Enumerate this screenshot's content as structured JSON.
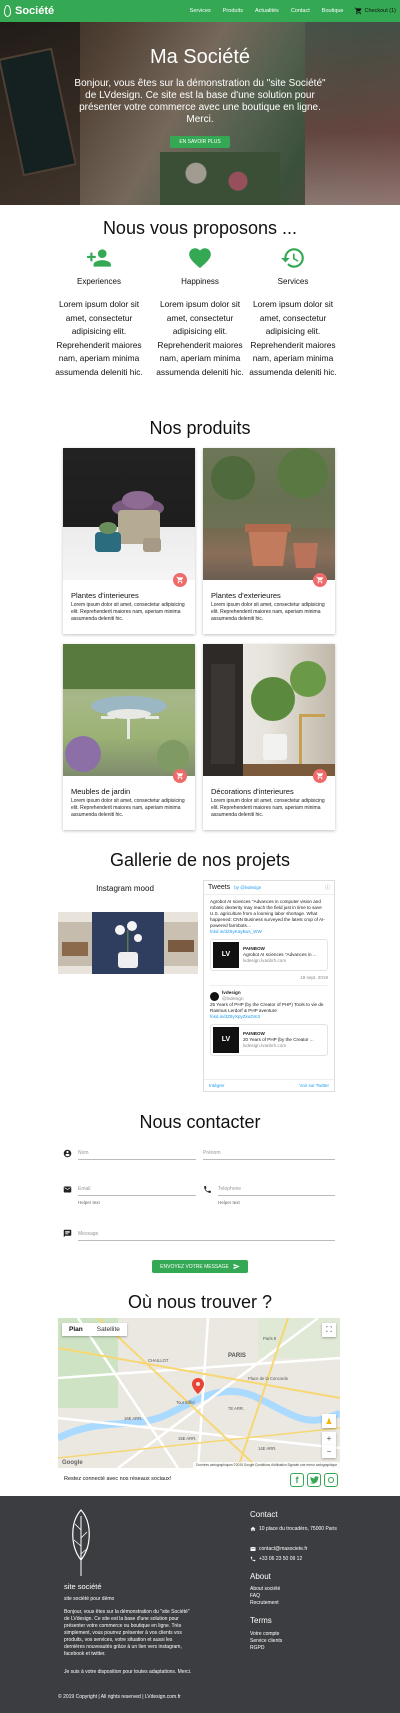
{
  "nav": {
    "brand": "Société",
    "links": [
      "Services",
      "Produits",
      "Actualités",
      "Contact",
      "Boutique"
    ],
    "cart": "Checkout (1)"
  },
  "hero": {
    "title": "Ma Société",
    "text": "Bonjour, vous êtes sur la démonstration du \"site Société\" de LVdesign. Ce site est la base d'une solution pour présenter votre commerce avec une boutique en ligne. Merci.",
    "button": "EN SAVOIR PLUS"
  },
  "services": {
    "title": "Nous vous proposons ...",
    "items": [
      {
        "title": "Experiences",
        "text": "Lorem ipsum dolor sit amet, consectetur adipisicing elit. Reprehenderit maiores nam, aperiam minima assumenda deleniti hic.",
        "icon": "person-add-icon"
      },
      {
        "title": "Happiness",
        "text": "Lorem ipsum dolor sit amet, consectetur adipisicing elit. Reprehenderit maiores nam, aperiam minima assumenda deleniti hic.",
        "icon": "heart-icon"
      },
      {
        "title": "Services",
        "text": "Lorem ipsum dolor sit amet, consectetur adipisicing elit. Reprehenderit maiores nam, aperiam minima assumenda deleniti hic.",
        "icon": "history-icon"
      }
    ]
  },
  "products": {
    "title": "Nos produits",
    "items": [
      {
        "title": "Plantes d'interieures",
        "text": "Lorem ipsum dolor sit amet, consectetur adipisicing elit. Reprehenderit maiores nam, aperiam minima assumenda deleniti hic."
      },
      {
        "title": "Plantes d'exterieures",
        "text": "Lorem ipsum dolor sit amet, consectetur adipisicing elit. Reprehenderit maiores nam, aperiam minima assumenda deleniti hic."
      },
      {
        "title": "Meubles de jardin",
        "text": "Lorem ipsum dolor sit amet, consectetur adipisicing elit. Reprehenderit maiores nam, aperiam minima assumenda deleniti hic."
      },
      {
        "title": "Décorations d'interieures",
        "text": "Lorem ipsum dolor sit amet, consectetur adipisicing elit. Reprehenderit maiores nam, aperiam minima assumenda deleniti hic."
      }
    ]
  },
  "gallery": {
    "title": "Gallerie de nos projets",
    "instagram_title": "Instagram mood",
    "twitter": {
      "header": "Tweets",
      "by": "by @lvdesign",
      "tweet1": "Agrobot AI sciences \"Advances in computer vision and robotic dexterity may reach the field just in time to save U.S. agriculture from a looming labor shortage. What happened: CNN Business surveyed the latest crop of AI-powered farmbots…",
      "tweet1_link": "lnkd.in/dZ6yKayBus_WW",
      "card1_title": "PAINBOW",
      "card1_text": "Agrobot AI sciences \"Advances in ...",
      "card1_domain": "lvdesign.lvanbrh.com",
      "card1_date": "18 sept. 2019",
      "author": "lvdesign",
      "handle": "@lvdesign",
      "tweet2": "25 Years of PHP (by the Creator of PHP) Tools to vie de Rasmus Lerdorf & PHP aventure",
      "tweet2_link": "lnkd.in/dZ9yXpyZkuDm3",
      "card2_title": "PAINBOW",
      "card2_text": "20 Years of PHP (by the Creator ...",
      "card2_domain": "lvdesign.lvanbrh.com",
      "embed": "Intégrer",
      "view": "Voir sur Twitter"
    }
  },
  "contact": {
    "title": "Nous contacter",
    "nom": "Nom",
    "prenom": "Prénom",
    "email": "Email",
    "telephone": "Telephone",
    "helper": "Helper text",
    "message": "Message",
    "send": "ENVOYEZ VOTRE MESSAGE"
  },
  "map": {
    "title": "Où nous trouver ?",
    "tab_plan": "Plan",
    "tab_satellite": "Satellite",
    "labels": [
      "CHAILLOT",
      "PARIS",
      "Place de la Concorde",
      "16E ARR.",
      "15E ARR.",
      "14E ARR.",
      "7E ARR.",
      "Tour Eiffel",
      "Paris 8"
    ],
    "footer": "Données cartographiques ©2019 Google   Conditions d'utilisation   Signaler une erreur cartographique",
    "google": "Google"
  },
  "social": {
    "text": "Restez connecté avec nos réseaux sociaux!",
    "icons": [
      "facebook-icon",
      "twitter-icon",
      "instagram-icon"
    ]
  },
  "footer": {
    "site": "site société",
    "sub": "site société pour démo",
    "desc": "Bonjour, vous êtes sur la démonstration du \"site Société\" de LVdesign. Ce site est la base d'une solution pour présenter votre commerce ou boutique en ligne. Très simplement, vous pourrez présenter à vos clients vos produits, vos services, votre situation et aussi les dernières nouveautés grâce à un lien vers instagram, facebook et twitter.",
    "note": "Je suis à votre disposition pour toutes adaptations. Merci.",
    "contact_title": "Contact",
    "address": "10 place du trocadéro, 75000 Paris",
    "email": "contact@masociete.fr",
    "phone": "+33 06 23 50 09 12",
    "about_title": "About",
    "about_items": [
      "About société",
      "FAQ",
      "Recrutement"
    ],
    "terms_title": "Terms",
    "terms_items": [
      "Votre compte",
      "Service clients",
      "RGPD"
    ],
    "copyright": "© 2019 Copyright | All rights reserved | LVdesign.com.fr"
  },
  "colors": {
    "accent": "#34a853",
    "cart_button": "#ef6b6b",
    "footer_bg": "#3b3d40"
  }
}
